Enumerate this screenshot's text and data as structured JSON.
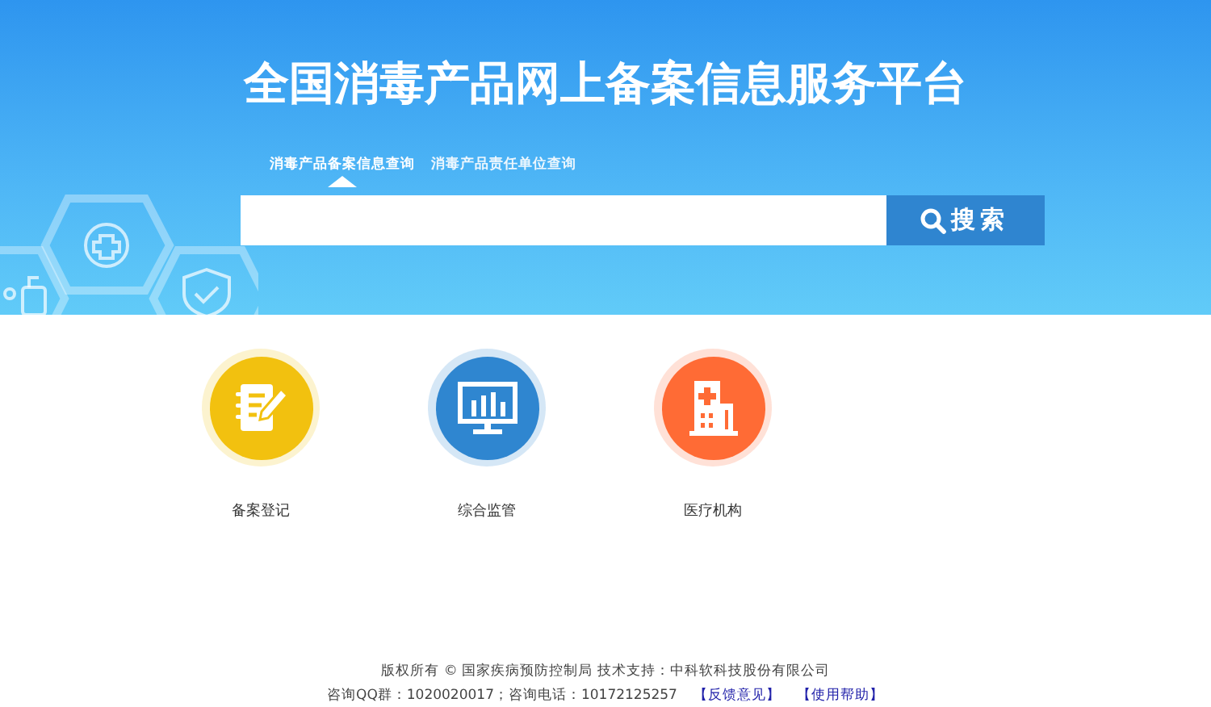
{
  "header": {
    "title": "全国消毒产品网上备案信息服务平台"
  },
  "tabs": [
    {
      "label": "消毒产品备案信息查询",
      "selected": true
    },
    {
      "label": "消毒产品责任单位查询",
      "selected": false
    }
  ],
  "search": {
    "button": "搜索"
  },
  "shortcuts": [
    {
      "kind": "register",
      "label": "备案登记",
      "color": "#f2c10f"
    },
    {
      "kind": "monitor",
      "label": "综合监管",
      "color": "#2f86d0"
    },
    {
      "kind": "hospital",
      "label": "医疗机构",
      "color": "#ff6b35"
    }
  ],
  "footer": {
    "copyright": "版权所有 © 国家疾病预防控制局  技术支持：中科软科技股份有限公司",
    "contact": "咨询QQ群：1020020017；咨询电话：10172125257",
    "links": [
      "【反馈意见】",
      "【使用帮助】"
    ]
  }
}
